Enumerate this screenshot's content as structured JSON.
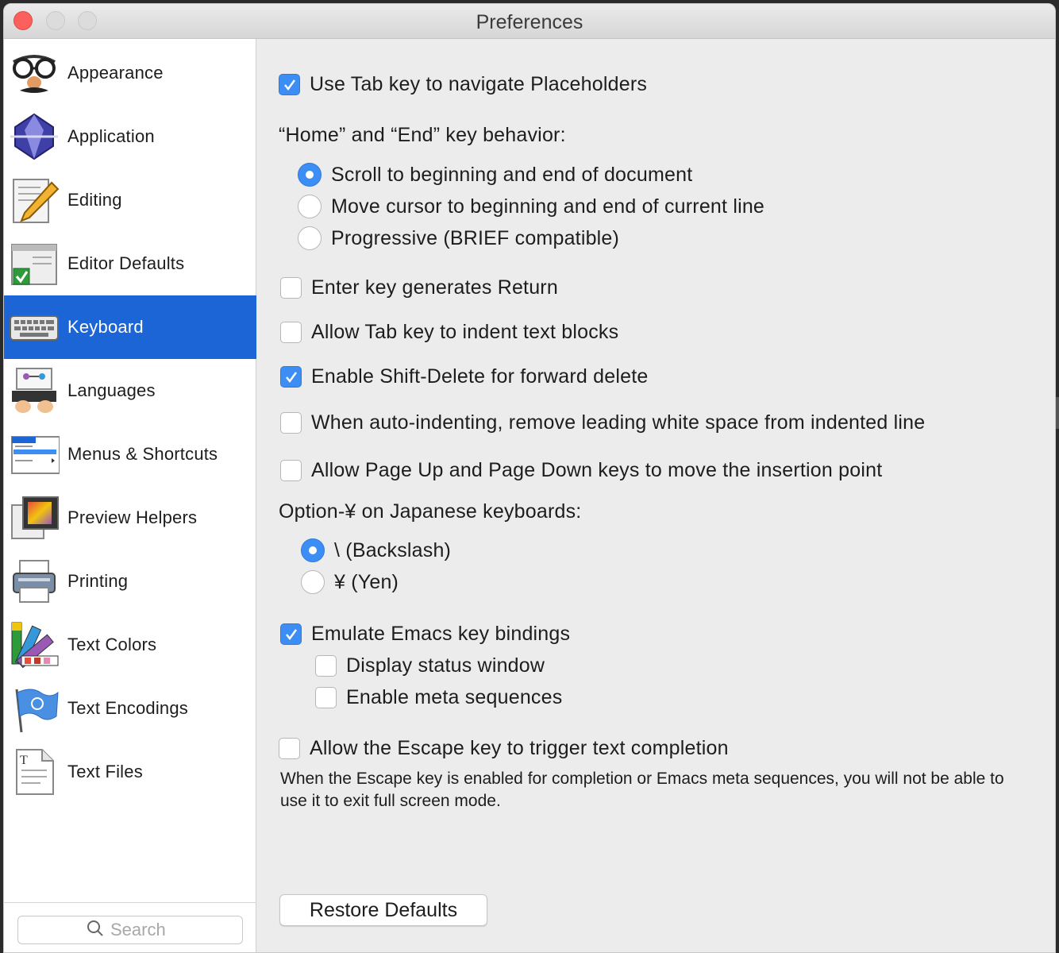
{
  "window": {
    "title": "Preferences"
  },
  "colors": {
    "accent": "#1b65d6",
    "check_on": "#3c8ef5",
    "close": "#fc605c"
  },
  "sidebar": {
    "items": [
      {
        "label": "Appearance",
        "icon": "groucho-glasses-icon",
        "selected": false
      },
      {
        "label": "Application",
        "icon": "app-gem-icon",
        "selected": false
      },
      {
        "label": "Editing",
        "icon": "pencil-document-icon",
        "selected": false
      },
      {
        "label": "Editor Defaults",
        "icon": "checked-document-icon",
        "selected": false
      },
      {
        "label": "Keyboard",
        "icon": "keyboard-icon",
        "selected": true
      },
      {
        "label": "Languages",
        "icon": "typing-hands-icon",
        "selected": false
      },
      {
        "label": "Menus & Shortcuts",
        "icon": "menu-icon",
        "selected": false
      },
      {
        "label": "Preview Helpers",
        "icon": "preview-icon",
        "selected": false
      },
      {
        "label": "Printing",
        "icon": "printer-icon",
        "selected": false
      },
      {
        "label": "Text Colors",
        "icon": "color-swatches-icon",
        "selected": false
      },
      {
        "label": "Text Encodings",
        "icon": "un-flag-icon",
        "selected": false
      },
      {
        "label": "Text Files",
        "icon": "text-file-icon",
        "selected": false
      }
    ],
    "search": {
      "placeholder": "Search",
      "value": ""
    }
  },
  "keyboard": {
    "use_tab_placeholders": {
      "label": "Use Tab key to navigate Placeholders",
      "checked": true
    },
    "home_end_heading": "“Home” and “End” key behavior:",
    "home_end_options": [
      {
        "label": "Scroll to beginning and end of document",
        "selected": true
      },
      {
        "label": "Move cursor to beginning and end of current line",
        "selected": false
      },
      {
        "label": "Progressive (BRIEF compatible)",
        "selected": false
      }
    ],
    "enter_return": {
      "label": "Enter key generates Return",
      "checked": false
    },
    "tab_indent": {
      "label": "Allow Tab key to indent text blocks",
      "checked": false
    },
    "shift_delete": {
      "label": "Enable Shift-Delete for forward delete",
      "checked": true
    },
    "auto_indent": {
      "label": "When auto-indenting, remove leading white space from indented line",
      "checked": false
    },
    "page_keys": {
      "label": "Allow Page Up and Page Down keys to move the insertion point",
      "checked": false
    },
    "yen_heading": "Option-¥ on Japanese keyboards:",
    "yen_options": [
      {
        "label": "\\ (Backslash)",
        "selected": true
      },
      {
        "label": "¥ (Yen)",
        "selected": false
      }
    ],
    "emacs": {
      "label": "Emacs key bindings",
      "prefix": "Emulate",
      "checked": true
    },
    "status_window": {
      "label": "Display status window",
      "checked": false
    },
    "meta_sequences": {
      "label": "Enable meta sequences",
      "checked": false
    },
    "escape_completion": {
      "label": "Allow the Escape key to trigger text completion",
      "checked": false
    },
    "note": "When the Escape key is enabled for completion or Emacs meta sequences, you will not be able to use it to exit full screen mode.",
    "restore_button": "Restore Defaults"
  }
}
